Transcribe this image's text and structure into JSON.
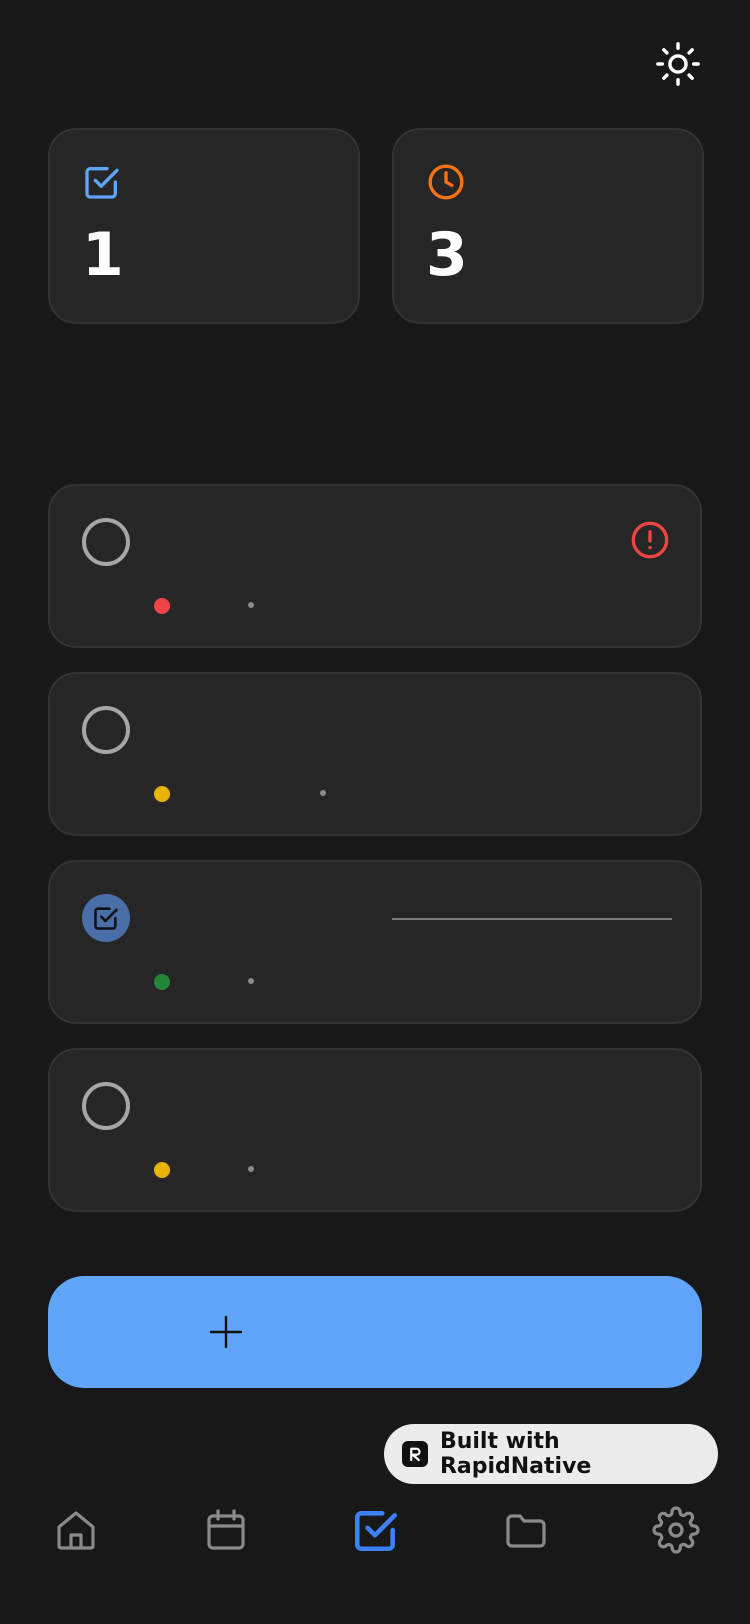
{
  "header": {
    "theme_icon": "sun-icon"
  },
  "stats": {
    "completed": {
      "icon": "checkbox-icon",
      "value": "1",
      "color": "#60a5fa"
    },
    "pending": {
      "icon": "clock-icon",
      "value": "3",
      "color": "#f97316"
    }
  },
  "tasks": [
    {
      "title": "",
      "priority_color": "#ef4444",
      "completed": false,
      "alert_icon": "alert-circle-icon",
      "alert_color": "#ef4444"
    },
    {
      "title": "",
      "priority_color": "#eab308",
      "completed": false
    },
    {
      "title": "",
      "priority_color": "#22863a",
      "completed": true
    },
    {
      "title": "",
      "priority_color": "#eab308",
      "completed": false
    }
  ],
  "add_button": {
    "icon": "plus-icon",
    "label": "",
    "color": "#60a5fa"
  },
  "badge": {
    "text": "Built with RapidNative"
  },
  "tabbar": {
    "active_color": "#3b82f6",
    "inactive_color": "#8a8a8a",
    "items": [
      {
        "icon": "home-icon",
        "active": false
      },
      {
        "icon": "calendar-icon",
        "active": false
      },
      {
        "icon": "checkbox-icon",
        "active": true
      },
      {
        "icon": "folder-icon",
        "active": false
      },
      {
        "icon": "settings-icon",
        "active": false
      }
    ]
  }
}
